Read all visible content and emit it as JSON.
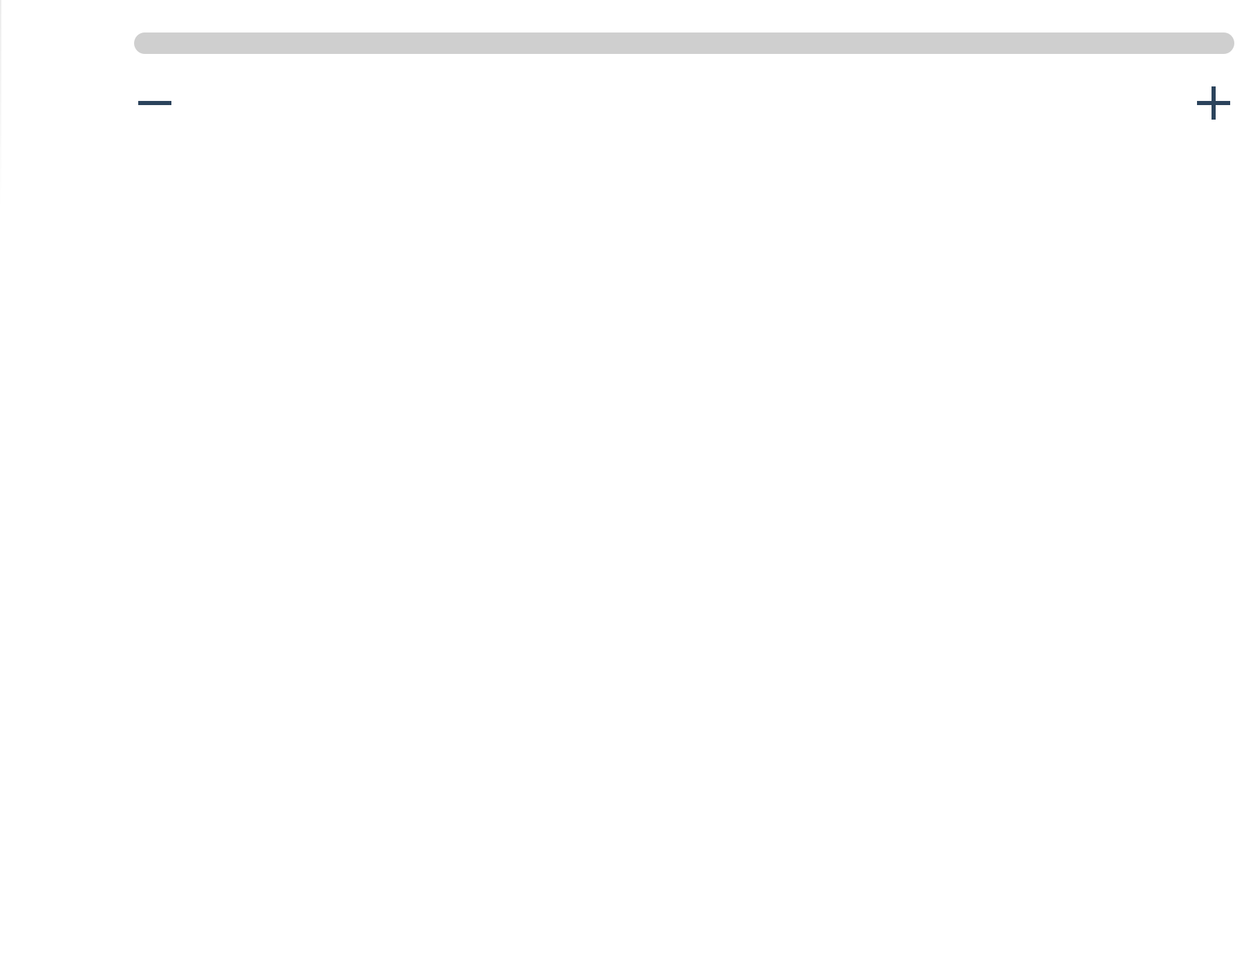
{
  "zoom_control": {
    "zoom_out_icon": "minus-icon",
    "zoom_in_icon": "plus-icon",
    "track_color": "#cfcfcf",
    "icon_color": "#2b435c"
  }
}
